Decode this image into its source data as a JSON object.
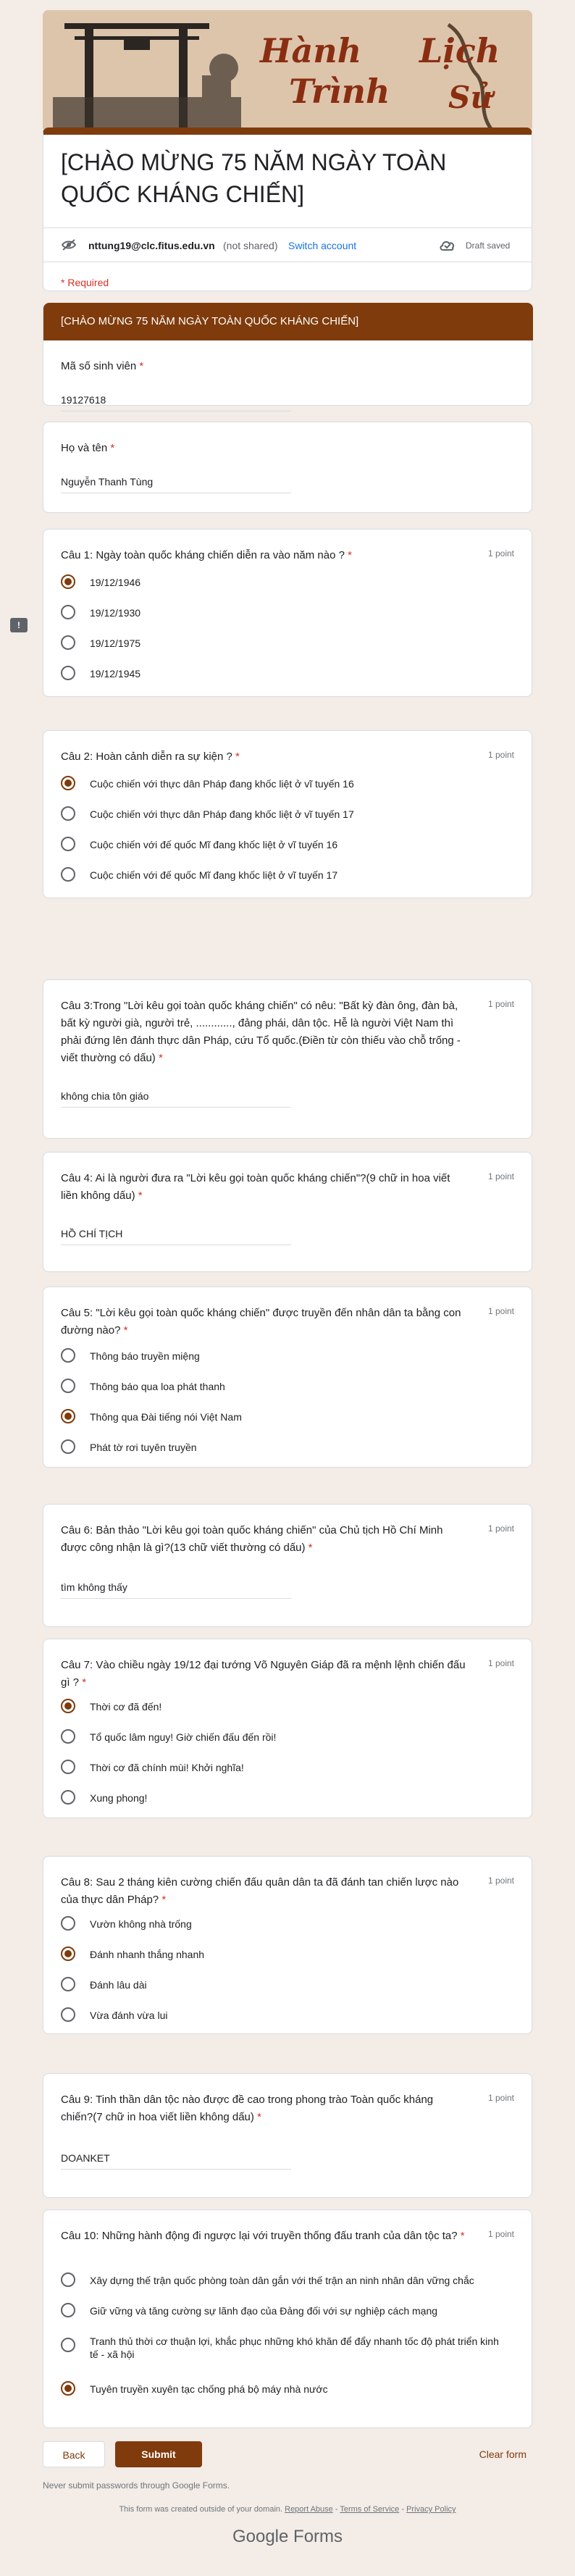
{
  "banner": {
    "text_line1": "Hành",
    "text_line2": "Trình",
    "text_line3": "Lịch",
    "text_line4": "Sử"
  },
  "form": {
    "title": "[CHÀO MỪNG 75 NĂM NGÀY TOÀN QUỐC KHÁNG CHIẾN]",
    "email": "nttung19@clc.fitus.edu.vn",
    "not_shared": "(not shared)",
    "switch_account": "Switch account",
    "draft": "Draft saved",
    "required": "* Required",
    "section": "[CHÀO MỪNG 75 NĂM NGÀY TOÀN QUỐC KHÁNG CHIẾN]"
  },
  "q_student_id": {
    "label": "Mã số sinh viên",
    "value": "19127618"
  },
  "q_name": {
    "label": "Họ và tên",
    "value": "Nguyễn Thanh Tùng"
  },
  "points": "1 point",
  "q1": {
    "label": "Câu 1: Ngày toàn quốc kháng chiến diễn ra vào năm nào ?",
    "options": [
      "19/12/1946",
      "19/12/1930",
      "19/12/1975",
      "19/12/1945"
    ],
    "selected": 0
  },
  "q2": {
    "label": "Câu 2: Hoàn cảnh diễn ra sự kiện ?",
    "options": [
      "Cuộc chiến với thực dân Pháp đang khốc liệt ở vĩ tuyến 16",
      "Cuộc chiến với thực dân Pháp đang khốc liệt ở vĩ tuyến 17",
      "Cuộc chiến với đế quốc Mĩ đang khốc liệt ở vĩ tuyến 16",
      "Cuộc chiến với đế quốc Mĩ đang khốc liệt ở vĩ tuyến 17"
    ],
    "selected": 0
  },
  "q3": {
    "label": "Câu 3:Trong \"Lời kêu gọi toàn quốc kháng chiến\" có nêu: \"Bất kỳ đàn ông, đàn bà, bất kỳ người già, người trẻ, ............, đảng phái, dân tộc. Hễ là người Việt Nam thì phải đứng lên đánh thực dân Pháp, cứu Tổ quốc.(Điền từ còn thiếu vào chỗ trống - viết thường có dấu)",
    "value": "không chia tôn giáo"
  },
  "q4": {
    "label": "Câu 4: Ai là người đưa ra \"Lời kêu gọi toàn quốc kháng chiến\"?(9 chữ in hoa viết liền không dấu)",
    "value": "HỒ CHÍ TỊCH"
  },
  "q5": {
    "label": "Câu 5: \"Lời kêu gọi toàn quốc kháng chiến\" được truyền đến nhân dân ta bằng con đường nào?",
    "options": [
      "Thông báo truyền miệng",
      "Thông báo qua loa phát thanh",
      "Thông qua Đài tiếng nói Việt Nam",
      "Phát tờ rơi tuyên truyền"
    ],
    "selected": 2
  },
  "q6": {
    "label": "Câu 6: Bản thảo \"Lời kêu gọi toàn quốc kháng chiến\" của Chủ tịch Hồ Chí Minh được công nhận là gì?(13 chữ viết thường có dấu)",
    "value": "tìm không thấy"
  },
  "q7": {
    "label": "Câu 7: Vào chiều ngày 19/12 đại tướng Võ Nguyên Giáp đã ra mệnh lệnh chiến đấu gì ?",
    "options": [
      "Thời cơ đã đến!",
      "Tổ quốc lâm nguy! Giờ chiến đấu đến rồi!",
      "Thời cơ đã chính mùi! Khởi nghĩa!",
      "Xung phong!"
    ],
    "selected": 0
  },
  "q8": {
    "label": "Câu 8: Sau 2 tháng kiên cường chiến đấu quân dân ta đã đánh tan chiến lược nào của thực dân Pháp?",
    "options": [
      "Vườn không nhà trống",
      "Đánh nhanh thắng nhanh",
      "Đánh lâu dài",
      "Vừa đánh vừa lui"
    ],
    "selected": 1
  },
  "q9": {
    "label": "Câu 9: Tinh thần dân tộc nào được đề cao trong phong trào Toàn quốc kháng chiến?(7 chữ in hoa viết liền không dấu)",
    "value": "DOANKET"
  },
  "q10": {
    "label": "Câu 10: Những hành động đi ngược lại với truyền thống đấu tranh của dân tộc ta?",
    "options": [
      "Xây dựng thế trận quốc phòng toàn dân gắn với thế trận an ninh nhân dân vững chắc",
      "Giữ vững và tăng cường sự lãnh đạo của Đảng đối với sự nghiệp cách mạng",
      "Tranh thủ thời cơ thuận lợi, khắc phục những khó khăn để đẩy nhanh tốc độ phát triển kinh tế - xã hội",
      "Tuyên truyền xuyên tạc chống phá bộ máy nhà nước"
    ],
    "selected": 3
  },
  "footer": {
    "back": "Back",
    "submit": "Submit",
    "clear": "Clear form",
    "never": "Never submit passwords through Google Forms.",
    "created": "This form was created outside of your domain.",
    "report": "Report Abuse",
    "terms": "Terms of Service",
    "privacy": "Privacy Policy",
    "brand_google": "Google",
    "brand_forms": "Forms"
  },
  "colors": {
    "accent": "#7f3b0c",
    "required": "#d93025",
    "background": "#f3ece7"
  }
}
